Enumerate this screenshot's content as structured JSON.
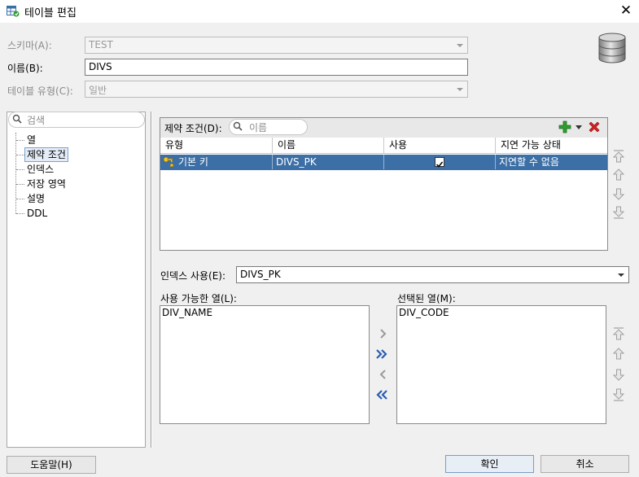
{
  "window": {
    "title": "테이블 편집",
    "close_glyph": "✕"
  },
  "form": {
    "schema_label": "스키마(A):",
    "schema_value": "TEST",
    "name_label": "이름(B):",
    "name_value": "DIVS",
    "table_type_label": "테이블 유형(C):",
    "table_type_value": "일반"
  },
  "nav": {
    "search_placeholder": "검색",
    "items": [
      {
        "label": "열"
      },
      {
        "label": "제약 조건"
      },
      {
        "label": "인덱스"
      },
      {
        "label": "저장 영역"
      },
      {
        "label": "설명"
      },
      {
        "label": "DDL"
      }
    ],
    "selected_index": 1
  },
  "constraints": {
    "label": "제약 조건(D):",
    "filter_placeholder": "이름",
    "columns": [
      "유형",
      "이름",
      "사용",
      "지연 가능 상태"
    ],
    "rows": [
      {
        "type": "기본 키",
        "name": "DIVS_PK",
        "enabled": true,
        "deferrable": "지연할 수 없음"
      }
    ]
  },
  "index": {
    "label": "인덱스 사용(E):",
    "value": "DIVS_PK"
  },
  "available": {
    "label": "사용 가능한 열(L):",
    "items": [
      "DIV_NAME"
    ]
  },
  "selected": {
    "label": "선택된 열(M):",
    "items": [
      "DIV_CODE"
    ]
  },
  "buttons": {
    "help": "도움말(H)",
    "ok": "확인",
    "cancel": "취소"
  },
  "colors": {
    "selection": "#3b6fa6",
    "add_icon": "#2e9e2e",
    "delete_icon": "#d62020",
    "transfer_arrows": "#2a5db0"
  }
}
